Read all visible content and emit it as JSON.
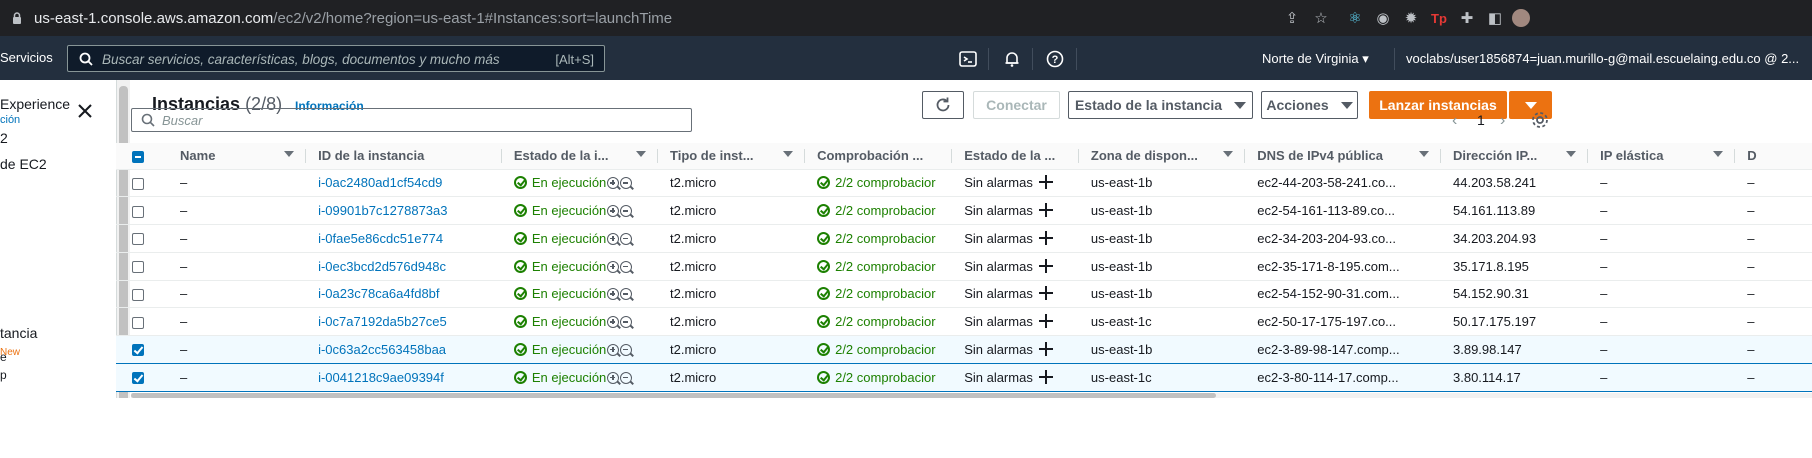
{
  "browser": {
    "url_host": "us-east-1.console.aws.amazon.com",
    "url_path": "/ec2/v2/home?region=us-east-1#Instances:sort=launchTime"
  },
  "nav": {
    "services": "Servicios",
    "search_placeholder": "Buscar servicios, características, blogs, documentos y mucho más",
    "search_shortcut": "[Alt+S]",
    "region": "Norte de Virginia",
    "user": "voclabs/user1856874=juan.murillo-g@mail.escuelaing.edu.co @ 2..."
  },
  "sidebar": {
    "experience": "Experience",
    "experience_sub": "ción",
    "items": [
      "2",
      "de EC2",
      "tancia",
      "e",
      "p"
    ],
    "new_badge": "New"
  },
  "main": {
    "title": "Instancias",
    "count": "(2/8)",
    "info": "Información",
    "btn_connect": "Conectar",
    "btn_state": "Estado de la instancia",
    "btn_actions": "Acciones",
    "btn_launch": "Lanzar instancias",
    "search_placeholder": "Buscar",
    "page": "1"
  },
  "table": {
    "columns": [
      "Name",
      "ID de la instancia",
      "Estado de la i...",
      "Tipo de inst...",
      "Comprobación ...",
      "Estado de la ...",
      "Zona de dispon...",
      "DNS de IPv4 pública",
      "Dirección IP...",
      "IP elástica",
      "D"
    ],
    "rows": [
      {
        "selected": false,
        "name": "–",
        "id": "i-0ac2480ad1cf54cd9",
        "state": "En ejecución",
        "type": "t2.micro",
        "checks": "2/2 comprobacior",
        "alarm": "Sin alarmas",
        "zone": "us-east-1b",
        "dns": "ec2-44-203-58-241.co...",
        "ip": "44.203.58.241",
        "eip": "–",
        "d": "–"
      },
      {
        "selected": false,
        "name": "–",
        "id": "i-09901b7c1278873a3",
        "state": "En ejecución",
        "type": "t2.micro",
        "checks": "2/2 comprobacior",
        "alarm": "Sin alarmas",
        "zone": "us-east-1b",
        "dns": "ec2-54-161-113-89.co...",
        "ip": "54.161.113.89",
        "eip": "–",
        "d": "–"
      },
      {
        "selected": false,
        "name": "–",
        "id": "i-0fae5e86cdc51e774",
        "state": "En ejecución",
        "type": "t2.micro",
        "checks": "2/2 comprobacior",
        "alarm": "Sin alarmas",
        "zone": "us-east-1b",
        "dns": "ec2-34-203-204-93.co...",
        "ip": "34.203.204.93",
        "eip": "–",
        "d": "–"
      },
      {
        "selected": false,
        "name": "–",
        "id": "i-0ec3bcd2d576d948c",
        "state": "En ejecución",
        "type": "t2.micro",
        "checks": "2/2 comprobacior",
        "alarm": "Sin alarmas",
        "zone": "us-east-1b",
        "dns": "ec2-35-171-8-195.com...",
        "ip": "35.171.8.195",
        "eip": "–",
        "d": "–"
      },
      {
        "selected": false,
        "name": "–",
        "id": "i-0a23c78ca6a4fd8bf",
        "state": "En ejecución",
        "type": "t2.micro",
        "checks": "2/2 comprobacior",
        "alarm": "Sin alarmas",
        "zone": "us-east-1b",
        "dns": "ec2-54-152-90-31.com...",
        "ip": "54.152.90.31",
        "eip": "–",
        "d": "–"
      },
      {
        "selected": false,
        "name": "–",
        "id": "i-0c7a7192da5b27ce5",
        "state": "En ejecución",
        "type": "t2.micro",
        "checks": "2/2 comprobacior",
        "alarm": "Sin alarmas",
        "zone": "us-east-1c",
        "dns": "ec2-50-17-175-197.co...",
        "ip": "50.17.175.197",
        "eip": "–",
        "d": "–"
      },
      {
        "selected": true,
        "name": "–",
        "id": "i-0c63a2cc563458baa",
        "state": "En ejecución",
        "type": "t2.micro",
        "checks": "2/2 comprobacior",
        "alarm": "Sin alarmas",
        "zone": "us-east-1b",
        "dns": "ec2-3-89-98-147.comp...",
        "ip": "3.89.98.147",
        "eip": "–",
        "d": "–"
      },
      {
        "selected": true,
        "name": "–",
        "id": "i-0041218c9ae09394f",
        "state": "En ejecución",
        "type": "t2.micro",
        "checks": "2/2 comprobacior",
        "alarm": "Sin alarmas",
        "zone": "us-east-1c",
        "dns": "ec2-3-80-114-17.comp...",
        "ip": "3.80.114.17",
        "eip": "–",
        "d": "–"
      }
    ]
  }
}
